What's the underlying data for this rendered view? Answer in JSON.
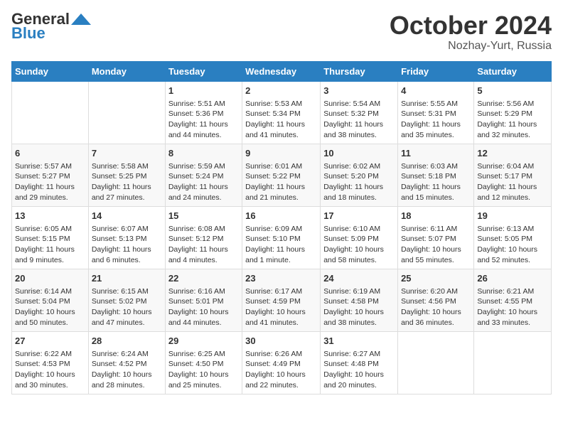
{
  "header": {
    "logo_general": "General",
    "logo_blue": "Blue",
    "month_year": "October 2024",
    "location": "Nozhay-Yurt, Russia"
  },
  "days_of_week": [
    "Sunday",
    "Monday",
    "Tuesday",
    "Wednesday",
    "Thursday",
    "Friday",
    "Saturday"
  ],
  "weeks": [
    [
      {
        "day": "",
        "content": ""
      },
      {
        "day": "",
        "content": ""
      },
      {
        "day": "1",
        "content": "Sunrise: 5:51 AM\nSunset: 5:36 PM\nDaylight: 11 hours and 44 minutes."
      },
      {
        "day": "2",
        "content": "Sunrise: 5:53 AM\nSunset: 5:34 PM\nDaylight: 11 hours and 41 minutes."
      },
      {
        "day": "3",
        "content": "Sunrise: 5:54 AM\nSunset: 5:32 PM\nDaylight: 11 hours and 38 minutes."
      },
      {
        "day": "4",
        "content": "Sunrise: 5:55 AM\nSunset: 5:31 PM\nDaylight: 11 hours and 35 minutes."
      },
      {
        "day": "5",
        "content": "Sunrise: 5:56 AM\nSunset: 5:29 PM\nDaylight: 11 hours and 32 minutes."
      }
    ],
    [
      {
        "day": "6",
        "content": "Sunrise: 5:57 AM\nSunset: 5:27 PM\nDaylight: 11 hours and 29 minutes."
      },
      {
        "day": "7",
        "content": "Sunrise: 5:58 AM\nSunset: 5:25 PM\nDaylight: 11 hours and 27 minutes."
      },
      {
        "day": "8",
        "content": "Sunrise: 5:59 AM\nSunset: 5:24 PM\nDaylight: 11 hours and 24 minutes."
      },
      {
        "day": "9",
        "content": "Sunrise: 6:01 AM\nSunset: 5:22 PM\nDaylight: 11 hours and 21 minutes."
      },
      {
        "day": "10",
        "content": "Sunrise: 6:02 AM\nSunset: 5:20 PM\nDaylight: 11 hours and 18 minutes."
      },
      {
        "day": "11",
        "content": "Sunrise: 6:03 AM\nSunset: 5:18 PM\nDaylight: 11 hours and 15 minutes."
      },
      {
        "day": "12",
        "content": "Sunrise: 6:04 AM\nSunset: 5:17 PM\nDaylight: 11 hours and 12 minutes."
      }
    ],
    [
      {
        "day": "13",
        "content": "Sunrise: 6:05 AM\nSunset: 5:15 PM\nDaylight: 11 hours and 9 minutes."
      },
      {
        "day": "14",
        "content": "Sunrise: 6:07 AM\nSunset: 5:13 PM\nDaylight: 11 hours and 6 minutes."
      },
      {
        "day": "15",
        "content": "Sunrise: 6:08 AM\nSunset: 5:12 PM\nDaylight: 11 hours and 4 minutes."
      },
      {
        "day": "16",
        "content": "Sunrise: 6:09 AM\nSunset: 5:10 PM\nDaylight: 11 hours and 1 minute."
      },
      {
        "day": "17",
        "content": "Sunrise: 6:10 AM\nSunset: 5:09 PM\nDaylight: 10 hours and 58 minutes."
      },
      {
        "day": "18",
        "content": "Sunrise: 6:11 AM\nSunset: 5:07 PM\nDaylight: 10 hours and 55 minutes."
      },
      {
        "day": "19",
        "content": "Sunrise: 6:13 AM\nSunset: 5:05 PM\nDaylight: 10 hours and 52 minutes."
      }
    ],
    [
      {
        "day": "20",
        "content": "Sunrise: 6:14 AM\nSunset: 5:04 PM\nDaylight: 10 hours and 50 minutes."
      },
      {
        "day": "21",
        "content": "Sunrise: 6:15 AM\nSunset: 5:02 PM\nDaylight: 10 hours and 47 minutes."
      },
      {
        "day": "22",
        "content": "Sunrise: 6:16 AM\nSunset: 5:01 PM\nDaylight: 10 hours and 44 minutes."
      },
      {
        "day": "23",
        "content": "Sunrise: 6:17 AM\nSunset: 4:59 PM\nDaylight: 10 hours and 41 minutes."
      },
      {
        "day": "24",
        "content": "Sunrise: 6:19 AM\nSunset: 4:58 PM\nDaylight: 10 hours and 38 minutes."
      },
      {
        "day": "25",
        "content": "Sunrise: 6:20 AM\nSunset: 4:56 PM\nDaylight: 10 hours and 36 minutes."
      },
      {
        "day": "26",
        "content": "Sunrise: 6:21 AM\nSunset: 4:55 PM\nDaylight: 10 hours and 33 minutes."
      }
    ],
    [
      {
        "day": "27",
        "content": "Sunrise: 6:22 AM\nSunset: 4:53 PM\nDaylight: 10 hours and 30 minutes."
      },
      {
        "day": "28",
        "content": "Sunrise: 6:24 AM\nSunset: 4:52 PM\nDaylight: 10 hours and 28 minutes."
      },
      {
        "day": "29",
        "content": "Sunrise: 6:25 AM\nSunset: 4:50 PM\nDaylight: 10 hours and 25 minutes."
      },
      {
        "day": "30",
        "content": "Sunrise: 6:26 AM\nSunset: 4:49 PM\nDaylight: 10 hours and 22 minutes."
      },
      {
        "day": "31",
        "content": "Sunrise: 6:27 AM\nSunset: 4:48 PM\nDaylight: 10 hours and 20 minutes."
      },
      {
        "day": "",
        "content": ""
      },
      {
        "day": "",
        "content": ""
      }
    ]
  ]
}
